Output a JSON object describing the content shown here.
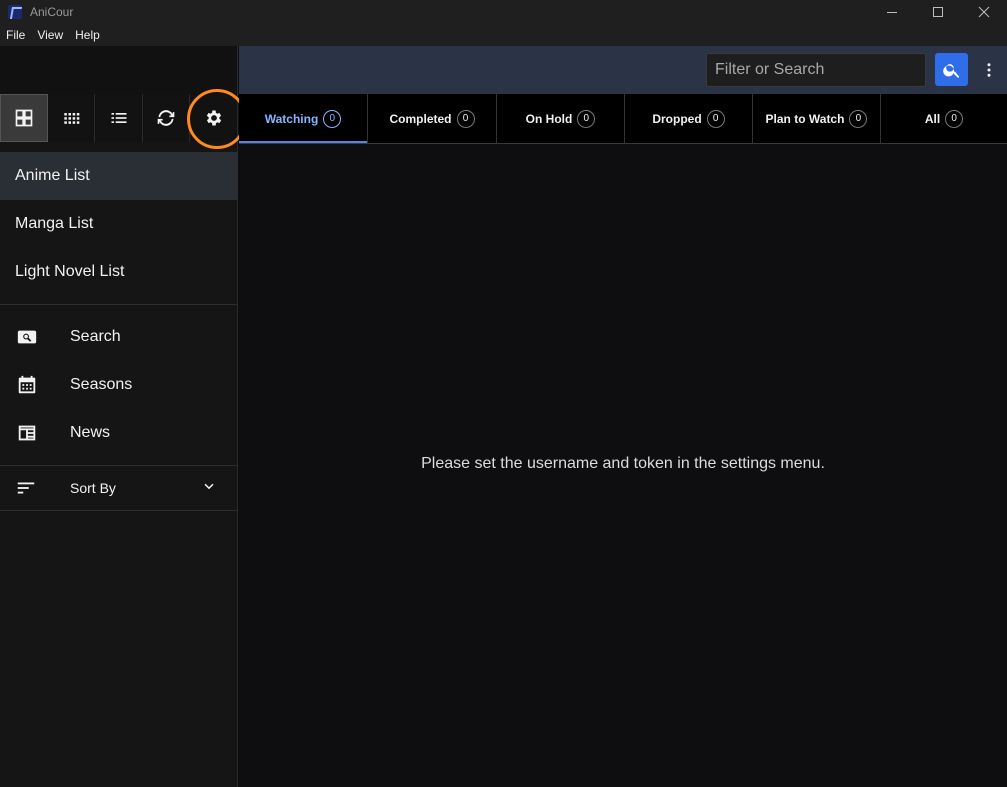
{
  "window": {
    "title": "AniCour"
  },
  "menubar": {
    "items": [
      "File",
      "View",
      "Help"
    ]
  },
  "viewbar": {
    "buttons": [
      {
        "name": "large-grid",
        "active": true
      },
      {
        "name": "small-grid",
        "active": false
      },
      {
        "name": "list",
        "active": false
      },
      {
        "name": "sync",
        "active": false
      },
      {
        "name": "settings",
        "active": false,
        "highlighted": true
      }
    ],
    "highlight_color": "#ff8a1f"
  },
  "sidebar": {
    "lists": [
      "Anime List",
      "Manga List",
      "Light Novel List"
    ],
    "selected_list": "Anime List",
    "tools": [
      {
        "label": "Search",
        "icon": "search-icon"
      },
      {
        "label": "Seasons",
        "icon": "calendar-icon"
      },
      {
        "label": "News",
        "icon": "news-icon"
      }
    ],
    "sort_label": "Sort By"
  },
  "header": {
    "search_placeholder": "Filter or Search",
    "accent": "#2f6ee8",
    "bar_color": "#2b3347"
  },
  "tabs": [
    {
      "label": "Watching",
      "count": "0",
      "active": true
    },
    {
      "label": "Completed",
      "count": "0",
      "active": false
    },
    {
      "label": "On Hold",
      "count": "0",
      "active": false
    },
    {
      "label": "Dropped",
      "count": "0",
      "active": false
    },
    {
      "label": "Plan to Watch",
      "count": "0",
      "active": false
    },
    {
      "label": "All",
      "count": "0",
      "active": false
    }
  ],
  "main": {
    "empty_message": "Please set the username and token in the settings menu."
  }
}
